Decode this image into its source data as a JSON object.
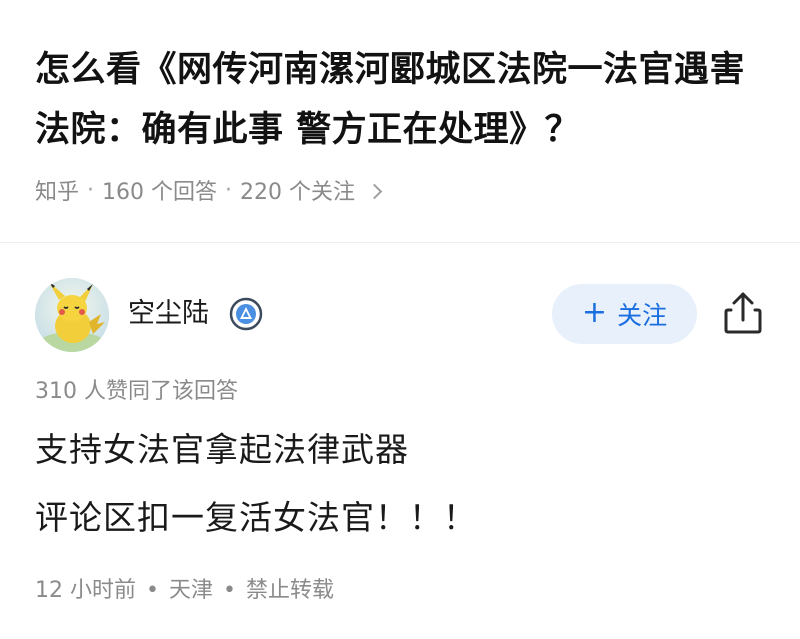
{
  "question": {
    "title": "怎么看《网传河南漯河郾城区法院一法官遇害 法院：确有此事 警方正在处理》？",
    "source": "知乎",
    "answers_count": "160 个回答",
    "followers_count": "220 个关注",
    "separator": "·"
  },
  "answer": {
    "author": {
      "name": "空尘陆",
      "avatar_icon": "pikachu-avatar",
      "badge_icon": "verified-badge-icon"
    },
    "follow_button": {
      "plus": "+",
      "label": "关注"
    },
    "share_icon": "share-icon",
    "upvote_text": "310 人赞同了该回答",
    "paragraphs": [
      "支持女法官拿起法律武器",
      "评论区扣一复活女法官！！！"
    ],
    "footer": {
      "time": "12 小时前",
      "location": "天津",
      "copyright": "禁止转载",
      "separator": "•"
    }
  },
  "colors": {
    "accent": "#1b6ee0",
    "follow_bg": "#e8f1fb",
    "muted_text": "#8a8a8a",
    "body_text": "#1a1a1a"
  }
}
